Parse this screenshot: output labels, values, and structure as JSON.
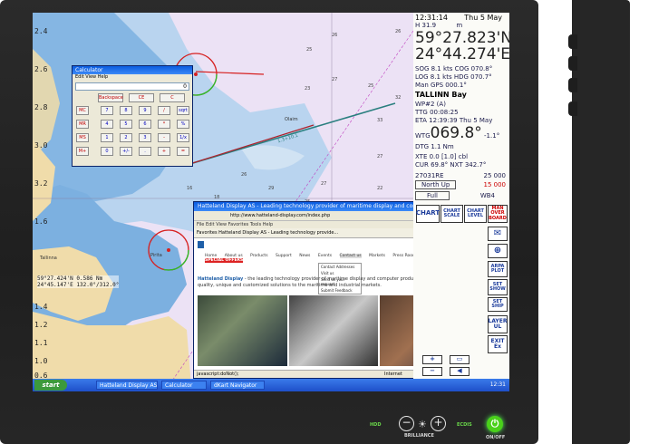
{
  "sidebar": {
    "time": "12:31:14",
    "date": "Thu 5 May",
    "heading_label": "H",
    "heading_value": "31.9",
    "heading_unit": "m",
    "lat": "59°27.823'N",
    "lon": "24°44.274'E",
    "sog": "SOG  8.1  kts COG 070.8°",
    "log": "LOG  8.1  kts HDG 070.7°",
    "man": "Man  GPS        000.1°",
    "place": "TALLINN Bay",
    "wp": "WP#2 (A)",
    "ttg": "TTG 00:08:25",
    "eta": "ETA 12:39:39 Thu 5 May",
    "wtg_label": "WTG",
    "wtg_value": "069.8°",
    "wtg_delta": "-1.1°",
    "dtg": "DTG  1.1  Nm",
    "xte": "XTE  0.0 [1.0]  cbl",
    "cur": "CUR  69.8° NXT 342.7°",
    "chart_id": "27031RE",
    "scale1": "25 000",
    "orientation": "North Up",
    "scale2": "15 000",
    "mode": "Full",
    "datum": "WB4",
    "chart_btn": "CHART",
    "chart_scale_btn": "CHART SCALE",
    "chart_level_btn": "CHART LEVEL",
    "man_overboard_btn": "MAN OVER BOARD",
    "arpa_plot": "ARPA PLOT",
    "set_show": "SET SHOW",
    "set_ship": "SET SHIP",
    "layer_ul": "LAYER UL",
    "exit_ex": "EXIT Ex",
    "zoom_minus": "−",
    "zoom_plus": "+"
  },
  "chart": {
    "lat_labels": [
      "2.4",
      "2.6",
      "2.8",
      "3.0",
      "3.2",
      "1.6"
    ],
    "pos_lat": "59°27.424'N",
    "pos_lon": "24°45.147'E",
    "pos_range": "0.586 Nm",
    "pos_bearing": "132.0°/312.0°",
    "lower_labels": [
      "1.4",
      "1.2",
      "1.1",
      "1.0",
      "0.8",
      "0.6"
    ],
    "route_label": "1.3+10.1",
    "place_1": "Olaim",
    "place_2": "Pirita",
    "place_3": "Tallinna"
  },
  "calculator": {
    "title": "Calculator",
    "menu": "Edit  View  Help",
    "display": "0",
    "top_buttons": [
      "Backspace",
      "CE",
      "C"
    ],
    "rows": [
      [
        "MC",
        "7",
        "8",
        "9",
        "/",
        "sqrt"
      ],
      [
        "MR",
        "4",
        "5",
        "6",
        "*",
        "%"
      ],
      [
        "MS",
        "1",
        "2",
        "3",
        "-",
        "1/x"
      ],
      [
        "M+",
        "0",
        "+/-",
        ".",
        "+",
        "="
      ]
    ]
  },
  "browser": {
    "title": "Hatteland Display AS - Leading technology provider of maritime display and computer products - Windows Internet Explorer",
    "address": "http://www.hatteland-display.com/index.php",
    "menu": "File  Edit  View  Favorites  Tools  Help",
    "favorites": "Favorites   Hatteland Display AS - Leading technology provide...",
    "nav": [
      "Home",
      "About us",
      "Products",
      "Support",
      "News",
      "Events",
      "Contact us",
      "Markets",
      "Press Room",
      "Careers",
      "SPECIAL OFFERS"
    ],
    "dropdown": [
      "Contact Addresses",
      "Visit us",
      "Send us your request",
      "Submit Feedback"
    ],
    "headline": "Hatteland Display",
    "body_text": "- the leading technology provider of maritime display and computer products, delivering high quality, unique and customized solutions to the maritime and industrial markets.",
    "status_left": "javascript:doNot();",
    "status_right": "Internet"
  },
  "taskbar": {
    "start": "start",
    "items": [
      "Hatteland Display AS ...",
      "Calculator",
      "dKart Navigator"
    ],
    "clock": "12:31"
  },
  "bezel": {
    "hdd": "HDD",
    "brilliance": "BRILLIANCE",
    "ecdis": "ECDIS",
    "onoff": "ON/OFF"
  },
  "colors": {
    "sea_deep": "#b7d3ee",
    "sea_shallow": "#7cb0e0",
    "land": "#f0dcaa",
    "route": "#2a7f7f",
    "onoff": "#4ad11a"
  }
}
